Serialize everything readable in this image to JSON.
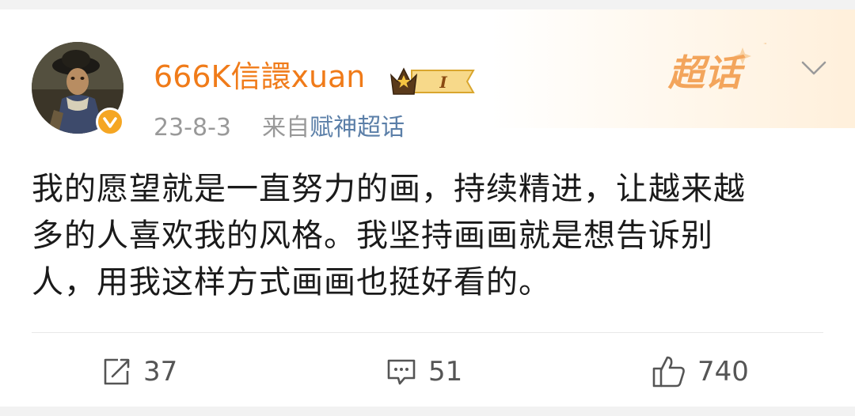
{
  "post": {
    "author": {
      "name": "666K信譞xuan",
      "vip_level": "I"
    },
    "meta": {
      "date": "23-8-3",
      "source_prefix": "来自",
      "source": "赋神超话"
    },
    "supertopic_label": "超话",
    "text_lines": [
      "我的愿望就是一直努力的画，持续精进，让越来越",
      "多的人喜欢我的风格。我坚持画画就是想告诉别",
      "人，用我这样方式画画也挺好看的。"
    ],
    "actions": {
      "repost_count": "37",
      "comment_count": "51",
      "like_count": "740"
    }
  },
  "colors": {
    "username": "#f07b19",
    "source_link": "#5b7fa8",
    "verify_badge": "#f5a623"
  },
  "icons": [
    "verified-badge-icon",
    "crown-icon",
    "chevron-down-icon",
    "repost-icon",
    "comment-icon",
    "like-icon"
  ]
}
